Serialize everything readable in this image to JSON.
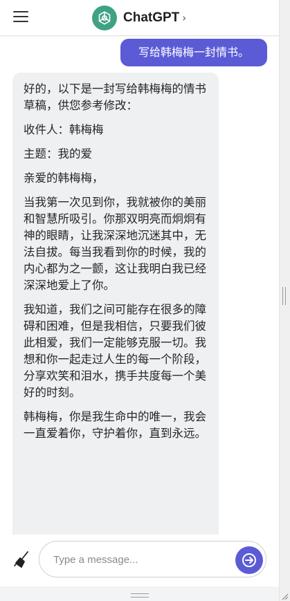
{
  "header": {
    "title": "ChatGPT",
    "chevron": "›"
  },
  "messages": {
    "user": "写给韩梅梅一封情书。",
    "bot": [
      "好的，以下是一封写给韩梅梅的情书草稿，供您参考修改：",
      "收件人：韩梅梅",
      "主题：我的爱",
      "亲爱的韩梅梅，",
      "当我第一次见到你，我就被你的美丽和智慧所吸引。你那双明亮而炯炯有神的眼睛，让我深深地沉迷其中，无法自拔。每当我看到你的时候，我的内心都为之一颤，这让我明白我已经深深地爱上了你。",
      "我知道，我们之间可能存在很多的障碍和困难，但是我相信，只要我们彼此相爱，我们一定能够克服一切。我想和你一起走过人生的每一个阶段，分享欢笑和泪水，携手共度每一个美好的时刻。",
      "韩梅梅，你是我生命中的唯一，我会一直爱着你，守护着你，直到永远。"
    ]
  },
  "composer": {
    "placeholder": "Type a message...",
    "value": ""
  },
  "icons": {
    "menu": "menu-icon",
    "logo": "openai-logo-icon",
    "clear": "broom-icon",
    "send": "arrow-right-icon"
  },
  "colors": {
    "accent": "#5b5bd6",
    "logo": "#3fa285",
    "bubble": "#eef0f2"
  }
}
